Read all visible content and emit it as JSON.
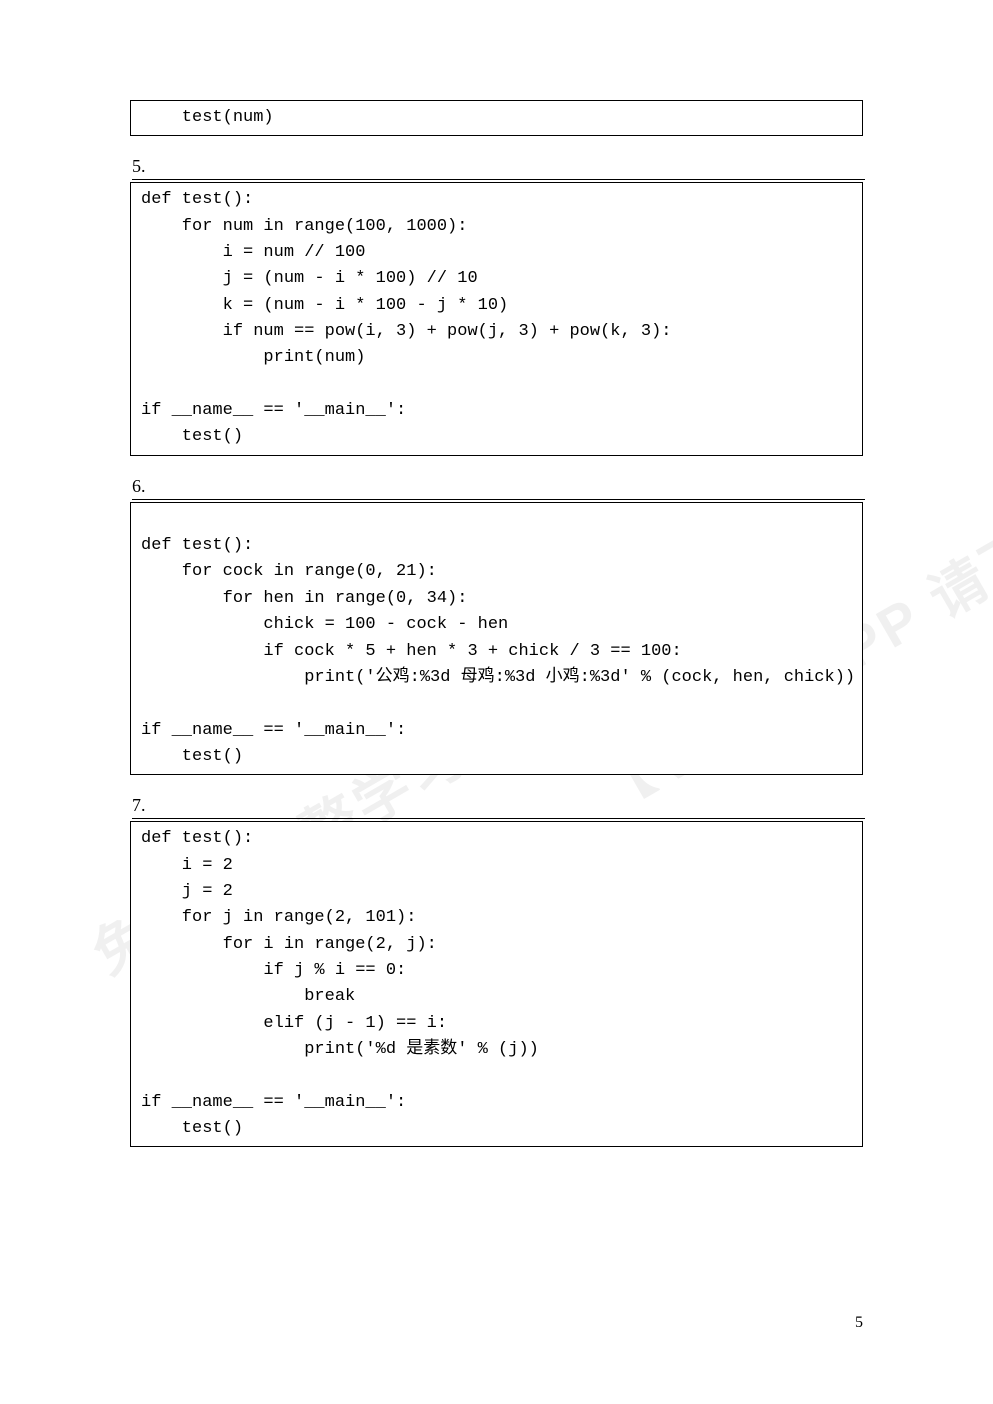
{
  "fragment": {
    "code": "    test(num)"
  },
  "sections": {
    "s5": {
      "label": "5.",
      "code": "def test():\n    for num in range(100, 1000):\n        i = num // 100\n        j = (num - i * 100) // 10\n        k = (num - i * 100 - j * 10)\n        if num == pow(i, 3) + pow(j, 3) + pow(k, 3):\n            print(num)\n\nif __name__ == '__main__':\n    test()"
    },
    "s6": {
      "label": "6.",
      "code": "\ndef test():\n    for cock in range(0, 21):\n        for hen in range(0, 34):\n            chick = 100 - cock - hen\n            if cock * 5 + hen * 3 + chick / 3 == 100:\n                print('公鸡:%3d 母鸡:%3d 小鸡:%3d' % (cock, hen, chick))\n\nif __name__ == '__main__':\n    test()"
    },
    "s7": {
      "label": "7.",
      "code": "def test():\n    i = 2\n    j = 2\n    for j in range(2, 101):\n        for i in range(2, j):\n            if j % i == 0:\n                break\n            elif (j - 1) == i:\n                print('%d 是素数' % (j))\n\nif __name__ == '__main__':\n    test()"
    }
  },
  "pageNumber": "5",
  "watermarks": {
    "a": "免费看完整学习资料",
    "b": "【小料】APP 请下载"
  }
}
